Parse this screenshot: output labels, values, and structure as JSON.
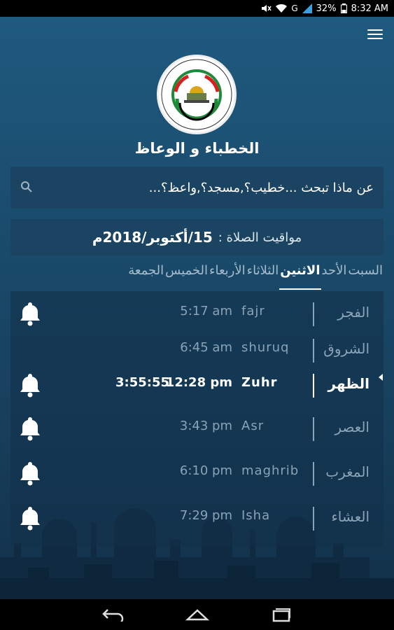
{
  "status_bar": {
    "battery": "32%",
    "time": "8:32 AM",
    "network": "G"
  },
  "app": {
    "title": "الخطباء و الوعاظ"
  },
  "search": {
    "placeholder": "عن ماذا تبحث ...خطيب؟,مسجد؟,واعظ؟..."
  },
  "prayer_date": {
    "label": "مواقيت الصلاة :",
    "value": "15/أكتوبر/2018م"
  },
  "days": [
    {
      "label": "السبت",
      "active": false
    },
    {
      "label": "الأحد",
      "active": false
    },
    {
      "label": "الاثنين",
      "active": true
    },
    {
      "label": "الثلاثاء",
      "active": false
    },
    {
      "label": "الأربعاء",
      "active": false
    },
    {
      "label": "الخميس",
      "active": false
    },
    {
      "label": "الجمعة",
      "active": false
    }
  ],
  "prayers": [
    {
      "arabic": "الفجر",
      "latin": "fajr",
      "time": "5:17 am",
      "bell": true,
      "current": false,
      "countdown": ""
    },
    {
      "arabic": "الشروق",
      "latin": "shuruq",
      "time": "6:45 am",
      "bell": false,
      "current": false,
      "countdown": ""
    },
    {
      "arabic": "الظهر",
      "latin": "Zuhr",
      "time": "12:28 pm",
      "bell": true,
      "current": true,
      "countdown": "3:55:55"
    },
    {
      "arabic": "العصر",
      "latin": "Asr",
      "time": "3:43 pm",
      "bell": true,
      "current": false,
      "countdown": ""
    },
    {
      "arabic": "المغرب",
      "latin": "maghrib",
      "time": "6:10 pm",
      "bell": true,
      "current": false,
      "countdown": ""
    },
    {
      "arabic": "العشاء",
      "latin": "Isha",
      "time": "7:29 pm",
      "bell": true,
      "current": false,
      "countdown": ""
    }
  ],
  "icons": {
    "menu": "menu-icon",
    "search": "search-icon",
    "bell": "bell-icon",
    "back": "back-icon",
    "home": "home-icon",
    "recents": "recents-icon"
  }
}
